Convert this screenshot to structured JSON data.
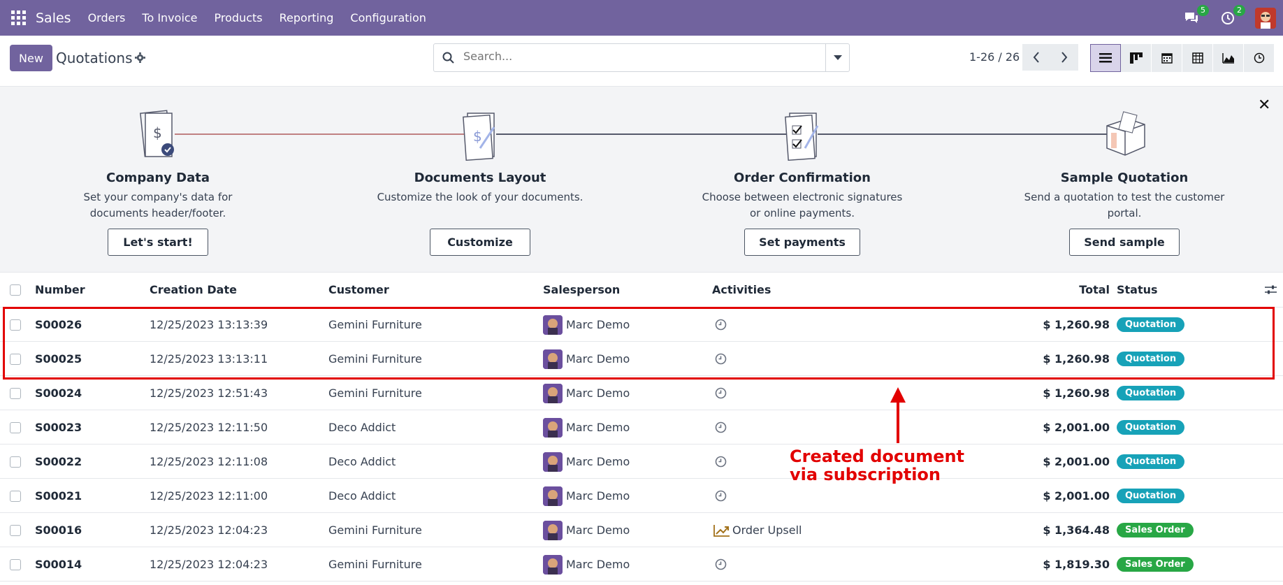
{
  "navbar": {
    "brand": "Sales",
    "menu": [
      "Orders",
      "To Invoice",
      "Products",
      "Reporting",
      "Configuration"
    ],
    "messages_count": "5",
    "activities_count": "2"
  },
  "control": {
    "new_label": "New",
    "title": "Quotations",
    "search_placeholder": "Search...",
    "pager": "1-26 / 26"
  },
  "onboarding": {
    "steps": [
      {
        "title": "Company Data",
        "desc": "Set your company's data for documents header/footer.",
        "button": "Let's start!"
      },
      {
        "title": "Documents Layout",
        "desc": "Customize the look of your documents.",
        "button": "Customize"
      },
      {
        "title": "Order Confirmation",
        "desc": "Choose between electronic signatures or online payments.",
        "button": "Set payments"
      },
      {
        "title": "Sample Quotation",
        "desc": "Send a quotation to test the customer portal.",
        "button": "Send sample"
      }
    ],
    "close": "✕"
  },
  "table": {
    "columns": {
      "number": "Number",
      "date": "Creation Date",
      "customer": "Customer",
      "salesperson": "Salesperson",
      "activities": "Activities",
      "total": "Total",
      "status": "Status"
    },
    "rows": [
      {
        "number": "S00026",
        "date": "12/25/2023 13:13:39",
        "customer": "Gemini Furniture",
        "salesperson": "Marc Demo",
        "activity": "",
        "total": "$ 1,260.98",
        "status": "Quotation"
      },
      {
        "number": "S00025",
        "date": "12/25/2023 13:13:11",
        "customer": "Gemini Furniture",
        "salesperson": "Marc Demo",
        "activity": "",
        "total": "$ 1,260.98",
        "status": "Quotation"
      },
      {
        "number": "S00024",
        "date": "12/25/2023 12:51:43",
        "customer": "Gemini Furniture",
        "salesperson": "Marc Demo",
        "activity": "",
        "total": "$ 1,260.98",
        "status": "Quotation"
      },
      {
        "number": "S00023",
        "date": "12/25/2023 12:11:50",
        "customer": "Deco Addict",
        "salesperson": "Marc Demo",
        "activity": "",
        "total": "$ 2,001.00",
        "status": "Quotation"
      },
      {
        "number": "S00022",
        "date": "12/25/2023 12:11:08",
        "customer": "Deco Addict",
        "salesperson": "Marc Demo",
        "activity": "",
        "total": "$ 2,001.00",
        "status": "Quotation"
      },
      {
        "number": "S00021",
        "date": "12/25/2023 12:11:00",
        "customer": "Deco Addict",
        "salesperson": "Marc Demo",
        "activity": "",
        "total": "$ 2,001.00",
        "status": "Quotation"
      },
      {
        "number": "S00016",
        "date": "12/25/2023 12:04:23",
        "customer": "Gemini Furniture",
        "salesperson": "Marc Demo",
        "activity": "Order Upsell",
        "total": "$ 1,364.48",
        "status": "Sales Order"
      },
      {
        "number": "S00014",
        "date": "12/25/2023 12:04:23",
        "customer": "Gemini Furniture",
        "salesperson": "Marc Demo",
        "activity": "",
        "total": "$ 1,819.30",
        "status": "Sales Order"
      }
    ]
  },
  "annotation": {
    "line1": "Created document",
    "line2": "via subscription"
  },
  "colors": {
    "brand": "#71639e",
    "quotation": "#17a2b8",
    "sales_order": "#28a745",
    "annotation": "#e20000"
  }
}
